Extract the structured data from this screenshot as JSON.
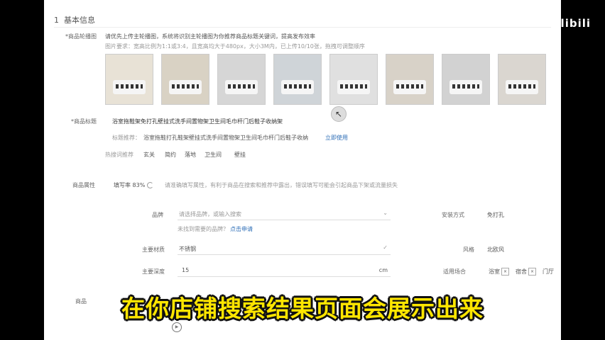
{
  "watermark": "bilibili",
  "subtitle": "在你店铺搜索结果页面会展示出来",
  "section": {
    "number": "1",
    "title": "基本信息"
  },
  "main_images": {
    "label": "*商品轮播图",
    "hint1": "请优先上传主轮播图，系统将识别主轮播图为你推荐商品标题关键词，提高发布效率",
    "hint2": "图片要求：宽高比例为1:1或3:4，且宽高均大于480px，大小3M内，已上传10/10张，拖拽可调整顺序",
    "thumbs": [
      {
        "name": "thumb-1",
        "color": "#e8e2d6"
      },
      {
        "name": "thumb-2",
        "color": "#d9d2c4"
      },
      {
        "name": "thumb-3",
        "color": "#d6d6d6"
      },
      {
        "name": "thumb-4",
        "color": "#cfd4d8"
      },
      {
        "name": "thumb-5",
        "color": "#e0e0e0"
      },
      {
        "name": "thumb-6",
        "color": "#d8d2c8"
      },
      {
        "name": "thumb-7",
        "color": "#d2d2d2"
      },
      {
        "name": "thumb-8",
        "color": "#dad6d0"
      }
    ]
  },
  "product_title": {
    "label": "*商品标题",
    "value": "浴室拖鞋架免打孔壁挂式洗手间置物架卫生间毛巾杆门后鞋子收纳架",
    "suggest_label": "标题推荐：",
    "suggest_value": "浴室拖鞋打孔鞋架壁挂式洗手间置物架卫生间毛巾杆门后鞋子收纳",
    "suggest_action": "立即使用",
    "keyword_label": "热搜词推荐",
    "keywords": [
      "玄关",
      "简约",
      "落地",
      "卫生间",
      "壁挂"
    ]
  },
  "attributes": {
    "label": "商品属性",
    "fill_rate": "填写率 83%",
    "fill_hint": "请准确填写属性，有利于商品在搜索和推荐中露出，错误填写可能会引起商品下架或流量损失",
    "brand_label": "品牌",
    "brand_placeholder": "请选择品牌，或输入搜索",
    "brand_missing": "未找到需要的品牌？",
    "brand_apply": "点击申请",
    "install_label": "安装方式",
    "install_value": "免打孔",
    "material_label": "主要材质",
    "material_value": "不锈钢",
    "style_label": "风格",
    "style_value": "北欧风",
    "depth_label": "主要深度",
    "depth_value": "15",
    "depth_unit": "cm",
    "scene_label": "适用场合",
    "scene_tags": [
      "浴室",
      "宿舍",
      "门厅"
    ]
  },
  "bottom_label": "商品"
}
